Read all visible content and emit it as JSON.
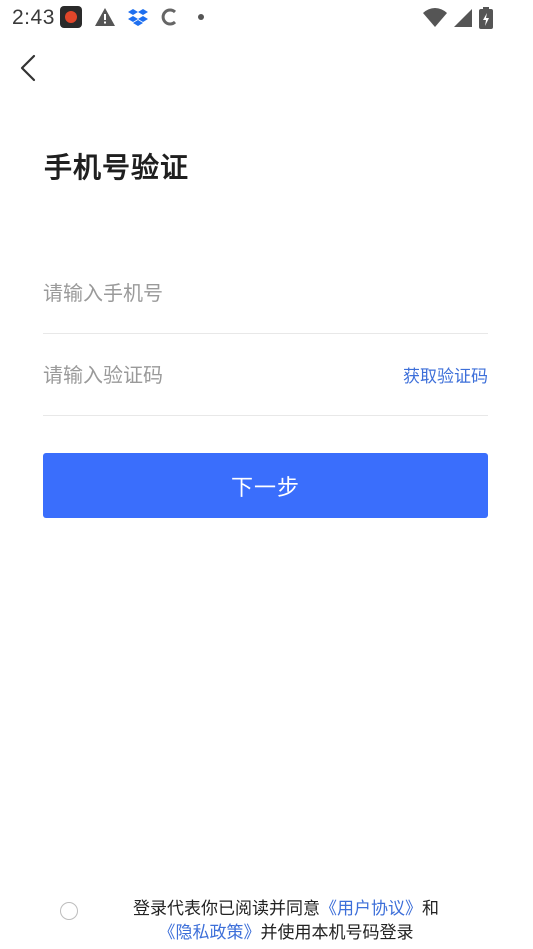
{
  "status_bar": {
    "time": "2:43",
    "icons": [
      "app-notification-icon",
      "warning-icon",
      "dropbox-icon",
      "c-app-icon",
      "dot-icon",
      "wifi-icon",
      "cell-signal-icon",
      "battery-icon"
    ]
  },
  "header": {
    "back_icon": "chevron-left-icon"
  },
  "page": {
    "title": "手机号验证"
  },
  "form": {
    "phone_placeholder": "请输入手机号",
    "phone_value": "",
    "code_placeholder": "请输入验证码",
    "code_value": "",
    "get_code_label": "获取验证码",
    "next_label": "下一步"
  },
  "agreement": {
    "prefix": "登录代表你已阅读并同意",
    "user_agreement": "《用户协议》",
    "and": "和",
    "privacy_policy": "《隐私政策》",
    "suffix": "并使用本机号码登录"
  },
  "colors": {
    "accent": "#3a6efc",
    "link": "#3d6fd9"
  }
}
